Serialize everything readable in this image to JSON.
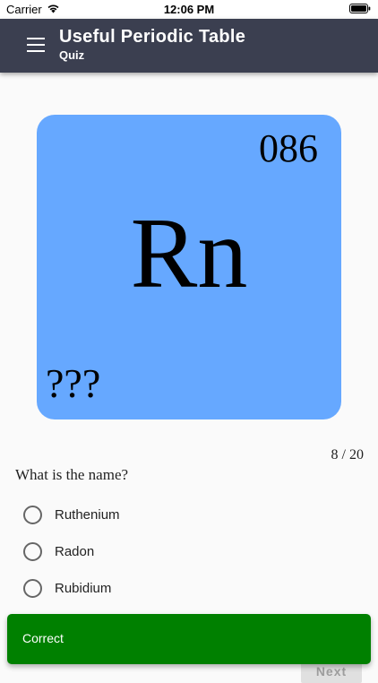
{
  "status_bar": {
    "carrier": "Carrier",
    "time": "12:06 PM",
    "wifi_icon": "wifi-icon",
    "battery_icon": "battery-icon"
  },
  "app_bar": {
    "title": "Useful Periodic Table",
    "subtitle": "Quiz",
    "menu_icon": "menu-icon",
    "background": "#3b3f50"
  },
  "element_card": {
    "atomic_number": "086",
    "symbol": "Rn",
    "name": "???",
    "color": "#66a8ff"
  },
  "quiz": {
    "progress": "8 / 20",
    "question": "What is the name?",
    "options": [
      {
        "label": "Ruthenium"
      },
      {
        "label": "Radon"
      },
      {
        "label": "Rubidium"
      }
    ],
    "next_label": "Next"
  },
  "snackbar": {
    "message": "Correct",
    "color": "#008000"
  }
}
